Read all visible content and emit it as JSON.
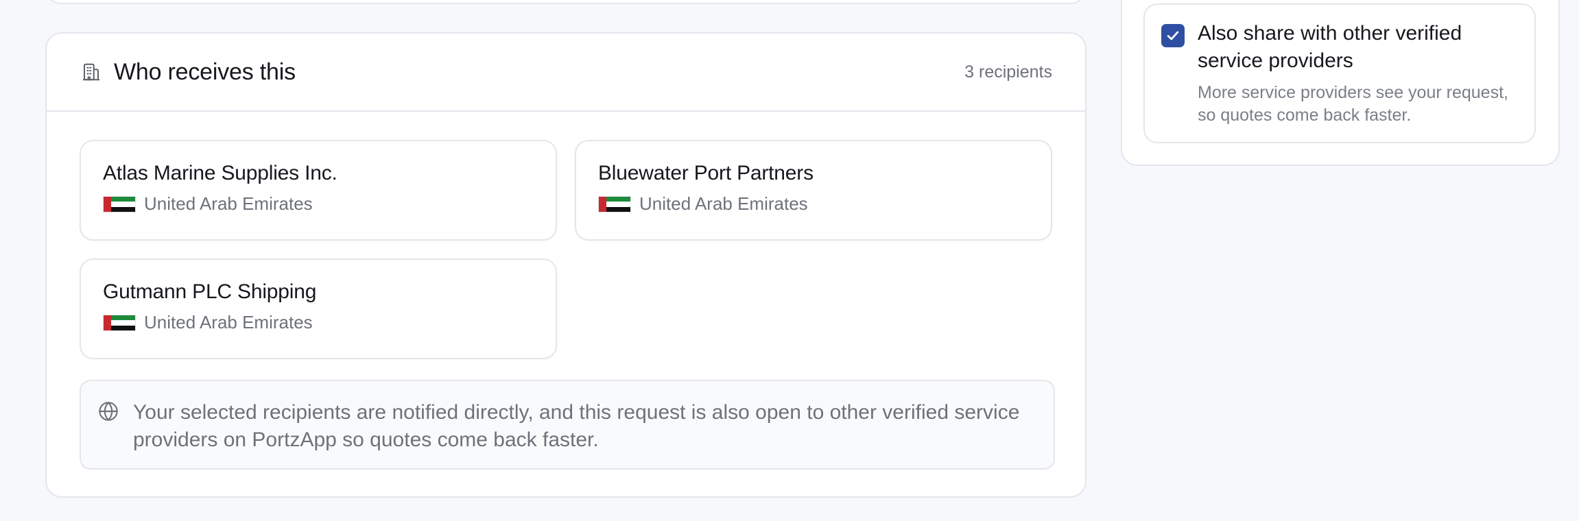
{
  "recipients_section": {
    "title": "Who receives this",
    "count_label": "3 recipients",
    "icon": "building-icon",
    "recipients": [
      {
        "name": "Atlas Marine Supplies Inc.",
        "country": "United Arab Emirates",
        "flag": "uae-flag-icon"
      },
      {
        "name": "Bluewater Port Partners",
        "country": "United Arab Emirates",
        "flag": "uae-flag-icon"
      },
      {
        "name": "Gutmann PLC Shipping",
        "country": "United Arab Emirates",
        "flag": "uae-flag-icon"
      }
    ],
    "notice": {
      "icon": "globe-icon",
      "text": "Your selected recipients are notified directly, and this request is also open to other verified service providers on PortzApp so quotes come back faster."
    }
  },
  "share_option": {
    "checked": true,
    "title": "Also share with other verified service providers",
    "description": "More service providers see your request, so quotes come back faster."
  },
  "colors": {
    "accent": "#2f4fa2",
    "border": "#e3e6ec",
    "muted_text": "#6d717a",
    "background": "#f6f8fc"
  }
}
